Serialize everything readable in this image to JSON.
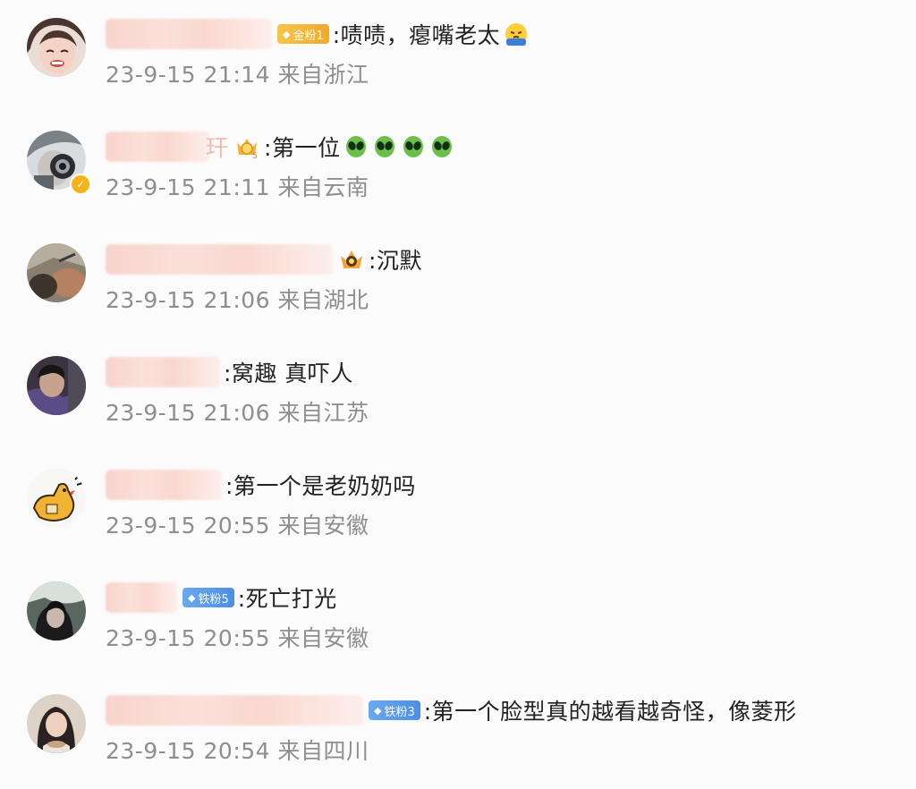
{
  "comments": [
    {
      "text": ":啧啧，瘪嘴老太",
      "badge_label": "金粉1",
      "time": "23-9-15 21:14",
      "location": "来自浙江",
      "emoji": "pouting-face-icon"
    },
    {
      "text": ":第一位",
      "partial_name_char": "玕",
      "time": "23-9-15 21:11",
      "location": "来自云南",
      "emoji": "alien-icon",
      "emoji_count": 4,
      "verified": true
    },
    {
      "text": ":沉默",
      "time": "23-9-15 21:06",
      "location": "来自湖北"
    },
    {
      "text": ":窝趣  真吓人",
      "time": "23-9-15 21:06",
      "location": "来自江苏"
    },
    {
      "text": ":第一个是老奶奶吗",
      "time": "23-9-15 20:55",
      "location": "来自安徽"
    },
    {
      "text": ":死亡打光",
      "badge_label": "铁粉5",
      "time": "23-9-15 20:55",
      "location": "来自安徽"
    },
    {
      "text": ":第一个脸型真的越看越奇怪，像菱形",
      "badge_label": "铁粉3",
      "time": "23-9-15 20:54",
      "location": "来自四川"
    }
  ],
  "colors": {
    "background": "#fbfbfb",
    "comment_text": "#222222",
    "meta_text": "#8e8e8e",
    "badge_gold": "#f2b030",
    "badge_iron": "#5a9bec",
    "name_blur": "#f8d4cc"
  }
}
